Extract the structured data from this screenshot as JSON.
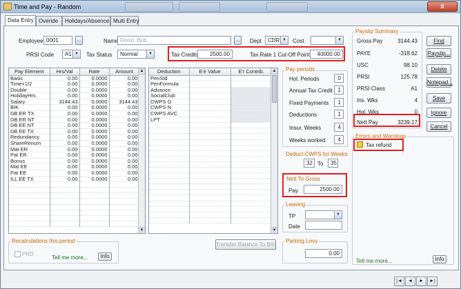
{
  "window": {
    "title": "Time and Pay - Random",
    "close_label": "x"
  },
  "tabs": [
    {
      "label": "Data Entry"
    },
    {
      "label": "Overide"
    },
    {
      "label": "Holidays/Absence"
    },
    {
      "label": "Multi Entry"
    }
  ],
  "header": {
    "employee_label": "Employee",
    "employee_value": "0001",
    "lookup_label": "...",
    "name_label": "Name",
    "name_value": "Flood, Bob",
    "dept_label": "Dept",
    "dept_value": "CDR",
    "cost_label": "Cost",
    "cost_value": "",
    "prsi_code_label": "PRSI Code",
    "prsi_code_value": "A1",
    "tax_status_label": "Tax Status",
    "tax_status_value": "Normal",
    "tax_credits_label": "Tax Credits",
    "tax_credits_value": "2500.00",
    "cutoff_label": "Tax Rate 1 Cut-Off Point",
    "cutoff_value": "40000.00"
  },
  "pay_grid": {
    "headers": [
      "Pay Element",
      "Hrs/Val",
      "Rate",
      "Amount"
    ],
    "rows": [
      [
        "Basic",
        "0.00",
        "0.0000",
        "0.00"
      ],
      [
        "Time+1/2",
        "0.00",
        "0.0000",
        "0.00"
      ],
      [
        "Double",
        "0.00",
        "0.0000",
        "0.00"
      ],
      [
        "HolidayHrs",
        "0.00",
        "0.0000",
        "0.00"
      ],
      [
        "Salary",
        "3144.43",
        "0.0000",
        "3144.43"
      ],
      [
        "BIK",
        "0.00",
        "0.0000",
        "0.00"
      ],
      [
        "DB ER TX",
        "0.00",
        "0.0000",
        "0.00"
      ],
      [
        "DB ER NT",
        "0.00",
        "0.0000",
        "0.00"
      ],
      [
        "DB EE NT",
        "0.00",
        "0.0000",
        "0.00"
      ],
      [
        "DB EE TX",
        "0.00",
        "0.0000",
        "0.00"
      ],
      [
        "Redundancy",
        "0.00",
        "0.0000",
        "0.00"
      ],
      [
        "ShareRenum",
        "0.00",
        "0.0000",
        "0.00"
      ],
      [
        "Mat ER",
        "0.00",
        "0.0000",
        "0.00"
      ],
      [
        "Pat ER",
        "0.00",
        "0.0000",
        "0.00"
      ],
      [
        "Bonus",
        "0.00",
        "0.0000",
        "0.00"
      ],
      [
        "Mat EE",
        "0.00",
        "0.0000",
        "0.00"
      ],
      [
        "Pat EE",
        "0.00",
        "0.0000",
        "0.00"
      ],
      [
        "ILL EE TX",
        "0.00",
        "0.0000",
        "0.00"
      ]
    ]
  },
  "ded_grid": {
    "headers": [
      "Deduction",
      "E'e Value",
      "E'r Contrib."
    ],
    "rows": [
      [
        "PenStd"
      ],
      [
        "PenFormula"
      ],
      [
        "Advance"
      ],
      [
        "SocialClub"
      ],
      [
        "CWPS G"
      ],
      [
        "CWPS N"
      ],
      [
        "CWPS AVC"
      ],
      [
        "LPT"
      ]
    ]
  },
  "pay_periods": {
    "title": "Pay periods",
    "fields": [
      {
        "label": "Hol. Periods",
        "value": "0"
      },
      {
        "label": "Annual Tax Credit",
        "value": "1"
      },
      {
        "label": "Fixed Payments",
        "value": "1"
      },
      {
        "label": "Deductions",
        "value": "1"
      },
      {
        "label": "Insur. Weeks",
        "value": "4"
      },
      {
        "label": "Weeks worked",
        "value": "4"
      }
    ]
  },
  "cwps": {
    "title": "Deduct CWPS for Weeks",
    "from": "32",
    "to_label": "To",
    "to": "35"
  },
  "nett_to_gross": {
    "title": "Nett To Gross",
    "pay_label": "Pay",
    "pay_value": "2500.00"
  },
  "leaving": {
    "title": "Leaving",
    "tp_label": "TP",
    "tp_value": "",
    "date_label": "Date",
    "date_value": ""
  },
  "parking": {
    "title": "Parking Levy",
    "value": "0.00"
  },
  "recalc": {
    "title": "Recalculations this period",
    "prd_label": "PRD",
    "tell_more": "Tell me more...",
    "info_label": "Info"
  },
  "transfer_label": "Transfer Balance To BIK",
  "payslip_summary": {
    "title": "Payslip Summary",
    "rows": [
      {
        "label": "Gross Pay",
        "value": "3144.43"
      },
      {
        "label": "PAYE",
        "value": "-318.62"
      },
      {
        "label": "USC",
        "value": "98.10"
      },
      {
        "label": "PRSI",
        "value": "125.78"
      },
      {
        "label": "PRSI Class",
        "value": "A1"
      },
      {
        "label": "Ins. Wks",
        "value": "4"
      },
      {
        "label": "Hol. Wks",
        "value": "0"
      }
    ],
    "nett_label": "Nett Pay",
    "nett_value": "3239.17"
  },
  "errors": {
    "title": "Errors and Warnings",
    "item": "Tax refund",
    "tell_more": "Tell me more...",
    "info_label": "Info"
  },
  "side_buttons": [
    "Find",
    "Payslip...",
    "Delete",
    "Notepad...",
    "Save",
    "Ignore",
    "Cancel"
  ],
  "nav": [
    "|◄",
    "◄",
    "►",
    "►|"
  ]
}
